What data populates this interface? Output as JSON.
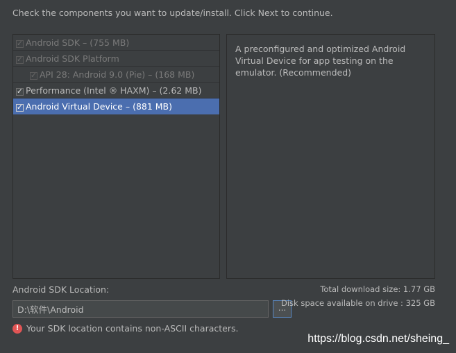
{
  "instruction": "Check the components you want to update/install. Click Next to continue.",
  "components": [
    {
      "label": "Android SDK – (755 MB)",
      "checked": true,
      "state": "disabled",
      "indent": 0
    },
    {
      "label": "Android SDK Platform",
      "checked": true,
      "state": "disabled",
      "indent": 0
    },
    {
      "label": "API 28: Android 9.0 (Pie) – (168 MB)",
      "checked": true,
      "state": "disabled",
      "indent": 1
    },
    {
      "label": "Performance (Intel ® HAXM) – (2.62 MB)",
      "checked": true,
      "state": "enabled",
      "indent": 0
    },
    {
      "label": "Android Virtual Device – (881 MB)",
      "checked": true,
      "state": "selected",
      "indent": 0
    }
  ],
  "description": "A preconfigured and optimized Android Virtual Device for app testing on the emulator. (Recommended)",
  "sdk_location": {
    "label": "Android SDK Location:",
    "value": "D:\\软件\\Android",
    "browse_label": "..."
  },
  "totals": {
    "download_size": "Total download size: 1.77 GB",
    "disk_space": "Disk space available on drive : 325 GB"
  },
  "warning": {
    "icon": "error-icon",
    "icon_glyph": "!",
    "text": "Your SDK location contains non-ASCII characters."
  },
  "watermark": "https://blog.csdn.net/sheing_",
  "colors": {
    "background": "#3c3f41",
    "selection": "#4b6eaf",
    "error": "#e05555"
  }
}
